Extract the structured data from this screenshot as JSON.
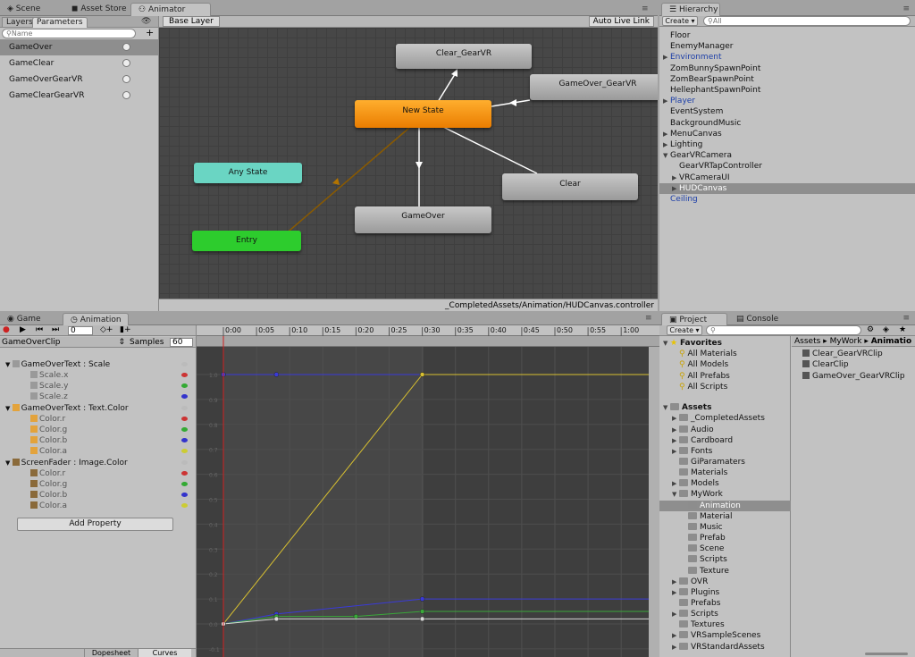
{
  "top_tabs": {
    "scene": "Scene",
    "asset_store": "Asset Store",
    "animator": "Animator"
  },
  "animator": {
    "subtabs": {
      "layers": "Layers",
      "parameters": "Parameters"
    },
    "search_placeholder": "Name",
    "add": "+",
    "breadcrumb": "Base Layer",
    "auto_live_link": "Auto Live Link",
    "parameters": [
      "GameOver",
      "GameClear",
      "GameOverGearVR",
      "GameClearGearVR"
    ],
    "states": {
      "clear_gearvr": "Clear_GearVR",
      "gameover_gearvr": "GameOver_GearVR",
      "new_state": "New State",
      "any_state": "Any State",
      "clear": "Clear",
      "gameover": "GameOver",
      "entry": "Entry"
    },
    "controller_path": "_CompletedAssets/Animation/HUDCanvas.controller"
  },
  "hierarchy": {
    "title": "Hierarchy",
    "create": "Create",
    "search_placeholder": "All",
    "items": [
      "Floor",
      "EnemyManager",
      "Environment",
      "ZomBunnySpawnPoint",
      "ZomBearSpawnPoint",
      "HellephantSpawnPoint",
      "Player",
      "EventSystem",
      "BackgroundMusic",
      "MenuCanvas",
      "Lighting",
      "GearVRCamera",
      "GearVRTapController",
      "VRCameraUI",
      "HUDCanvas",
      "Ceiling"
    ]
  },
  "bottom_tabs": {
    "game": "Game",
    "animation": "Animation"
  },
  "animation": {
    "clip": "GameOverClip",
    "samples_label": "Samples",
    "samples": "60",
    "frame": "0",
    "add_property": "Add Property",
    "dopesheet": "Dopesheet",
    "curves": "Curves",
    "properties": [
      {
        "label": "GameOverText : Scale",
        "header": true
      },
      {
        "label": "Scale.x",
        "color": "#c33"
      },
      {
        "label": "Scale.y",
        "color": "#3a3"
      },
      {
        "label": "Scale.z",
        "color": "#33c"
      },
      {
        "label": "GameOverText : Text.Color",
        "header": true
      },
      {
        "label": "Color.r",
        "color": "#c33"
      },
      {
        "label": "Color.g",
        "color": "#3a3"
      },
      {
        "label": "Color.b",
        "color": "#33c"
      },
      {
        "label": "Color.a",
        "color": "#cc3"
      },
      {
        "label": "ScreenFader : Image.Color",
        "header": true
      },
      {
        "label": "Color.r",
        "color": "#c33"
      },
      {
        "label": "Color.g",
        "color": "#3a3"
      },
      {
        "label": "Color.b",
        "color": "#33c"
      },
      {
        "label": "Color.a",
        "color": "#cc3"
      }
    ],
    "ruler": [
      "0:00",
      "0:05",
      "0:10",
      "0:15",
      "0:20",
      "0:25",
      "0:30",
      "0:35",
      "0:40",
      "0:45",
      "0:50",
      "0:55",
      "1:00"
    ],
    "y_ticks": [
      "1.0",
      "0.9",
      "0.8",
      "0.7",
      "0.6",
      "0.5",
      "0.4",
      "0.3",
      "0.2",
      "0.1",
      "0.0",
      "-0.1"
    ]
  },
  "project": {
    "tabs": {
      "project": "Project",
      "console": "Console"
    },
    "create": "Create",
    "favorites_title": "Favorites",
    "favorites": [
      "All Materials",
      "All Models",
      "All Prefabs",
      "All Scripts"
    ],
    "assets_title": "Assets",
    "folders": [
      "_CompletedAssets",
      "Audio",
      "Cardboard",
      "Fonts",
      "GiParamaters",
      "Materials",
      "Models",
      "MyWork",
      "Animation",
      "Material",
      "Music",
      "Prefab",
      "Scene",
      "Scripts",
      "Texture",
      "OVR",
      "Plugins",
      "Prefabs",
      "Scripts",
      "Textures",
      "VRSampleScenes",
      "VRStandardAssets"
    ],
    "breadcrumb": [
      "Assets",
      "MyWork",
      "Animatio"
    ],
    "files": [
      "Clear_GearVRClip",
      "ClearClip",
      "GameOver_GearVRClip"
    ]
  }
}
